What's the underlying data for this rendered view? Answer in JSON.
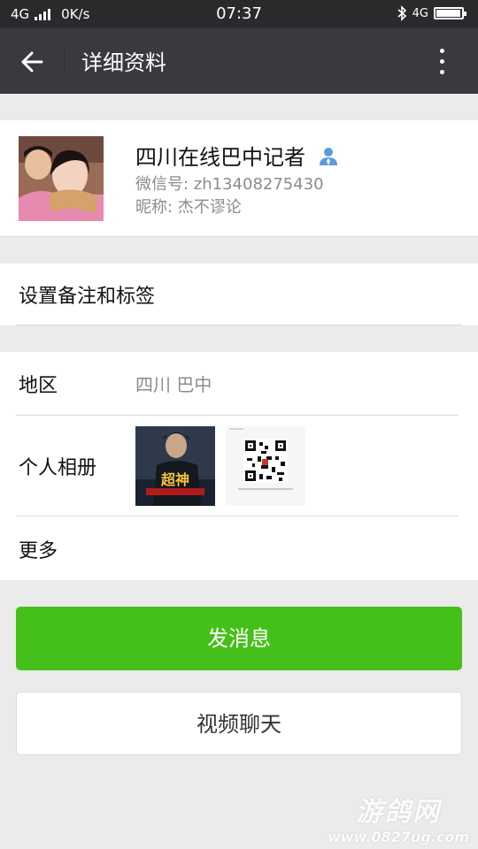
{
  "status_bar": {
    "network": "4G",
    "speed": "0K/s",
    "time": "07:37",
    "network_right": "4G",
    "battery_level": 0.95
  },
  "app_bar": {
    "title": "详细资料"
  },
  "profile": {
    "name": "四川在线巴中记者",
    "wechat_id": "微信号: zh13408275430",
    "nickname": "昵称: 杰不谬论"
  },
  "remark": {
    "label": "设置备注和标签"
  },
  "info": {
    "region_label": "地区",
    "region_value": "四川  巴中",
    "album_label": "个人相册",
    "album_thumb1_text": "超神",
    "more_label": "更多"
  },
  "buttons": {
    "send_message": "发消息",
    "video_chat": "视频聊天"
  },
  "watermark": {
    "line1": "游鸽网",
    "line2": "www.0827ug.com"
  },
  "colors": {
    "app_bar": "#393a3f",
    "status_bar": "#2a2a2c",
    "primary_button": "#45c01a",
    "background": "#ebebeb"
  }
}
